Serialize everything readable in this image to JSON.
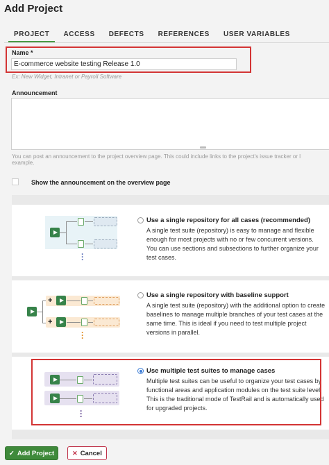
{
  "page_title": "Add Project",
  "tabs": [
    {
      "label": "PROJECT",
      "active": true
    },
    {
      "label": "ACCESS",
      "active": false
    },
    {
      "label": "DEFECTS",
      "active": false
    },
    {
      "label": "REFERENCES",
      "active": false
    },
    {
      "label": "USER VARIABLES",
      "active": false
    }
  ],
  "name_field": {
    "label": "Name *",
    "value": "E-commerce website testing Release 1.0",
    "hint": "Ex: New Widget, Intranet or Payroll Software"
  },
  "announcement": {
    "label": "Announcement",
    "value": "",
    "hint_line1": "You can post an announcement to the project overview page. This could include links to the project's issue tracker or l",
    "hint_line2": "example."
  },
  "show_announcement": {
    "label": "Show the announcement on the overview page",
    "checked": false
  },
  "options": [
    {
      "title": "Use a single repository for all cases (recommended)",
      "description": "A single test suite (repository) is easy to manage and flexible enough for most projects with no or few concurrent versions. You can use sections and subsections to further organize your test cases.",
      "selected": false
    },
    {
      "title": "Use a single repository with baseline support",
      "description": "A single test suite (repository) with the additional option to create baselines to manage multiple branches of your test cases at the same time. This is ideal if you need to test multiple project versions in parallel.",
      "selected": false
    },
    {
      "title": "Use multiple test suites to manage cases",
      "description": "Multiple test suites can be useful to organize your test cases by functional areas and application modules on the test suite level. This is the traditional mode of TestRail and is automatically used for upgraded projects.",
      "selected": true
    }
  ],
  "buttons": {
    "add_project": "Add Project",
    "cancel": "Cancel",
    "add_icon": "✓",
    "cancel_icon": "✕"
  },
  "colors": {
    "accent_green": "#3f8a3b",
    "highlight_red": "#d33434",
    "radio_blue": "#3a7bd5",
    "cancel_red": "#c0334a"
  }
}
